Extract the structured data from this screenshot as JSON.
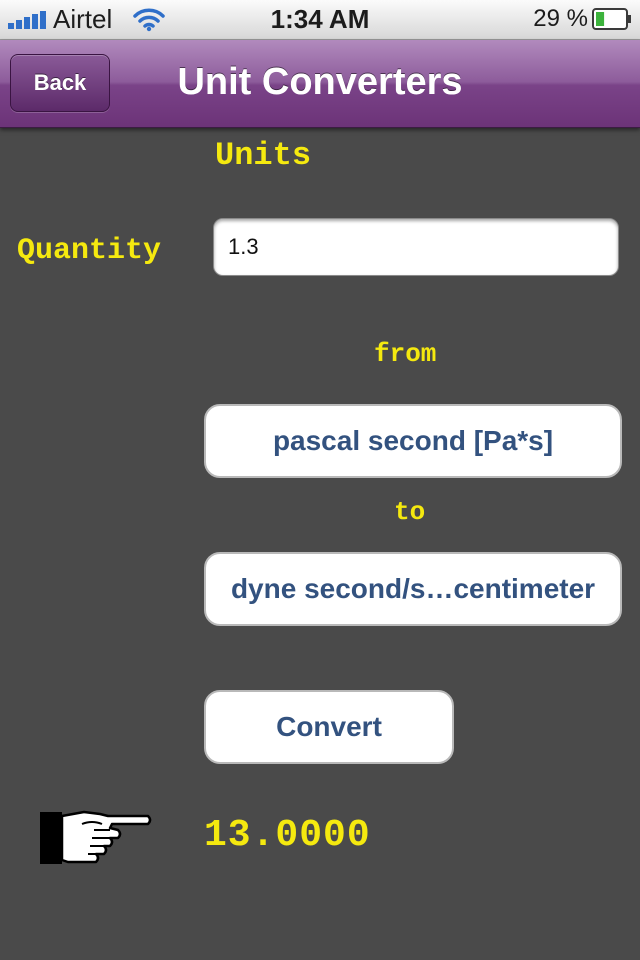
{
  "status_bar": {
    "carrier": "Airtel",
    "time": "1:34 AM",
    "battery_percent": "29 %",
    "battery_level": 0.29,
    "signal_icon": "signal-bars-icon",
    "wifi_icon": "wifi-icon",
    "battery_icon": "battery-icon"
  },
  "nav": {
    "back_label": "Back",
    "title": "Unit Converters"
  },
  "content": {
    "heading": "Units",
    "quantity_label": "Quantity",
    "quantity_value": "1.3",
    "from_label": "from",
    "from_unit": "pascal second [Pa*s]",
    "to_label": "to",
    "to_unit": "dyne second/s…centimeter",
    "convert_label": "Convert",
    "result": "13.0000",
    "pointer_icon": "pointing-hand-icon"
  },
  "colors": {
    "background": "#4a4a4a",
    "nav_purple": "#7a4388",
    "label_yellow": "#f5e90f",
    "button_text_blue": "#33527f"
  }
}
